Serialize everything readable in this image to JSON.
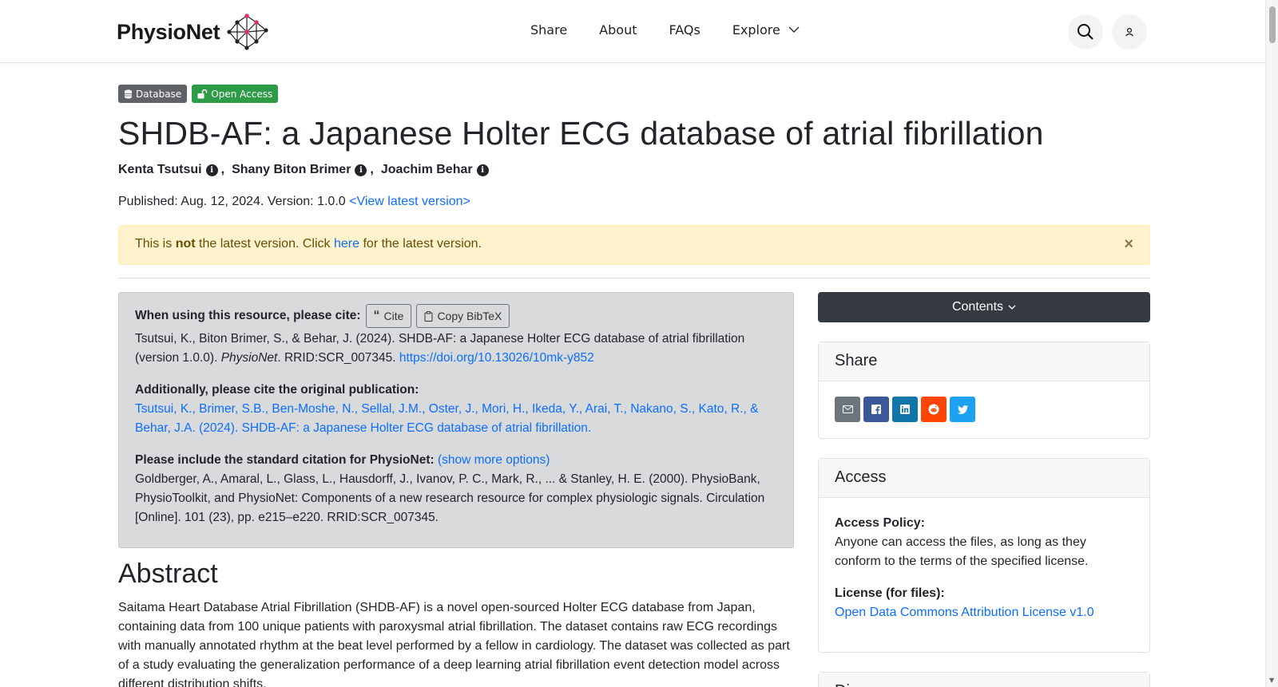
{
  "nav": {
    "brand": "PhysioNet",
    "links": [
      "Share",
      "About",
      "FAQs"
    ],
    "explore": "Explore"
  },
  "badges": {
    "database": "Database",
    "open_access": "Open Access"
  },
  "title": "SHDB-AF: a Japanese Holter ECG database of atrial fibrillation",
  "authors": [
    "Kenta Tsutsui",
    "Shany Biton Brimer",
    "Joachim Behar"
  ],
  "published": {
    "text": "Published: Aug. 12, 2024. Version: 1.0.0",
    "latest_link": "<View latest version>"
  },
  "alert": {
    "prefix": "This is",
    "strong": "not",
    "middle": "the latest version. Click",
    "link": "here",
    "suffix": "for the latest version.",
    "close": "×"
  },
  "citation": {
    "heading": "When using this resource, please cite:",
    "cite_btn": "Cite",
    "bibtex_btn": "Copy BibTeX",
    "text_pre": "Tsutsui, K., Biton Brimer, S., & Behar, J. (2024). SHDB-AF: a Japanese Holter ECG database of atrial fibrillation (version 1.0.0).",
    "text_italic": "PhysioNet",
    "text_post": ". RRID:SCR_007345.",
    "doi": "https://doi.org/10.13026/10mk-y852",
    "original_heading": "Additionally, please cite the original publication:",
    "original_link": "Tsutsui, K., Brimer, S.B., Ben-Moshe, N., Sellal, J.M., Oster, J., Mori, H., Ikeda, Y., Arai, T., Nakano, S., Kato, R., & Behar, J.A. (2024). SHDB-AF: a Japanese Holter ECG database of atrial fibrillation.",
    "standard_heading": "Please include the standard citation for PhysioNet:",
    "show_more": "(show more options)",
    "standard_text": "Goldberger, A., Amaral, L., Glass, L., Hausdorff, J., Ivanov, P. C., Mark, R., ... & Stanley, H. E. (2000). PhysioBank, PhysioToolkit, and PhysioNet: Components of a new research resource for complex physiologic signals. Circulation [Online]. 101 (23), pp. e215–e220. RRID:SCR_007345."
  },
  "abstract": {
    "title": "Abstract",
    "text": "Saitama Heart Database Atrial Fibrillation (SHDB-AF) is a novel open-sourced Holter ECG database from Japan, containing data from 100 unique patients with paroxysmal atrial fibrillation. The dataset contains raw ECG recordings with manually annotated rhythm at the beat level performed by a fellow in cardiology. The dataset was collected as part of a study evaluating the generalization performance of a deep learning atrial fibrillation event detection model across different distribution shifts."
  },
  "sidebar": {
    "contents": "Contents",
    "share_title": "Share",
    "access_title": "Access",
    "access_policy_label": "Access Policy:",
    "access_policy_text": "Anyone can access the files, as long as they conform to the terms of the specified license.",
    "license_label": "License (for files):",
    "license_link": "Open Data Commons Attribution License v1.0",
    "next_title": "Di"
  },
  "colors": {
    "email": "#6c757d",
    "facebook": "#3b5998",
    "linkedin": "#0e76a8",
    "reddit": "#ff4500",
    "twitter": "#1da1f2"
  }
}
